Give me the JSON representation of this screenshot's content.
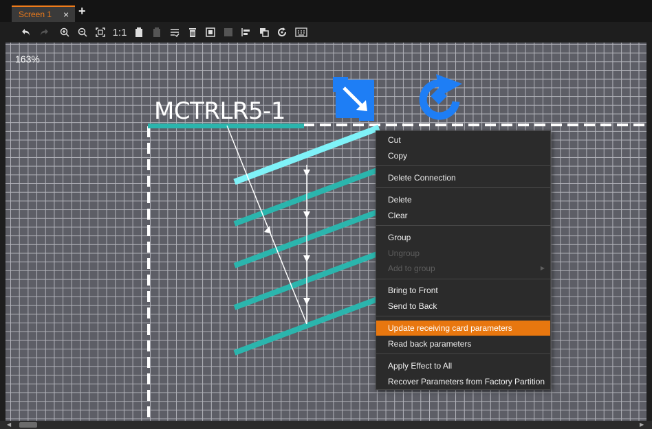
{
  "tabs": {
    "active_label": "Screen 1",
    "close_glyph": "×",
    "add_glyph": "+"
  },
  "toolbar": {
    "icons": [
      "undo-icon",
      "redo-icon",
      "zoom-in-icon",
      "zoom-out-icon",
      "fit-screen-icon",
      "actual-size-icon",
      "paste-icon",
      "paste-disabled-icon",
      "checklist-icon",
      "delete-icon",
      "select-all-icon",
      "group-disabled-icon",
      "align-icon",
      "layer-icon",
      "rotate-icon",
      "keyboard-icon"
    ],
    "actual_size_label": "1:1"
  },
  "canvas": {
    "zoom_level": "163%",
    "device_label": "MCTRLR5-1"
  },
  "context_menu": {
    "items": [
      {
        "label": "Cut",
        "disabled": false
      },
      {
        "label": "Copy",
        "disabled": false
      },
      {
        "label": "Delete Connection",
        "disabled": false
      },
      {
        "label": "Delete",
        "disabled": false
      },
      {
        "label": "Clear",
        "disabled": false
      },
      {
        "label": "Group",
        "disabled": false
      },
      {
        "label": "Ungroup",
        "disabled": true
      },
      {
        "label": "Add to group",
        "disabled": true,
        "submenu": true
      },
      {
        "label": "Bring to Front",
        "disabled": false
      },
      {
        "label": "Send to Back",
        "disabled": false
      },
      {
        "label": "Update receiving card parameters",
        "disabled": false,
        "highlighted": true
      },
      {
        "label": "Read back parameters",
        "disabled": false
      },
      {
        "label": "Apply Effect to All",
        "disabled": false
      },
      {
        "label": "Recover Parameters from Factory Partition",
        "disabled": false
      }
    ]
  },
  "colors": {
    "accent": "#f07c1a",
    "highlight": "#e8770f",
    "teal": "#2bb5ad",
    "cyan_selected": "#7ff2f8",
    "handle_blue": "#1e7ef5",
    "canvas_bg": "#5d5e66"
  }
}
